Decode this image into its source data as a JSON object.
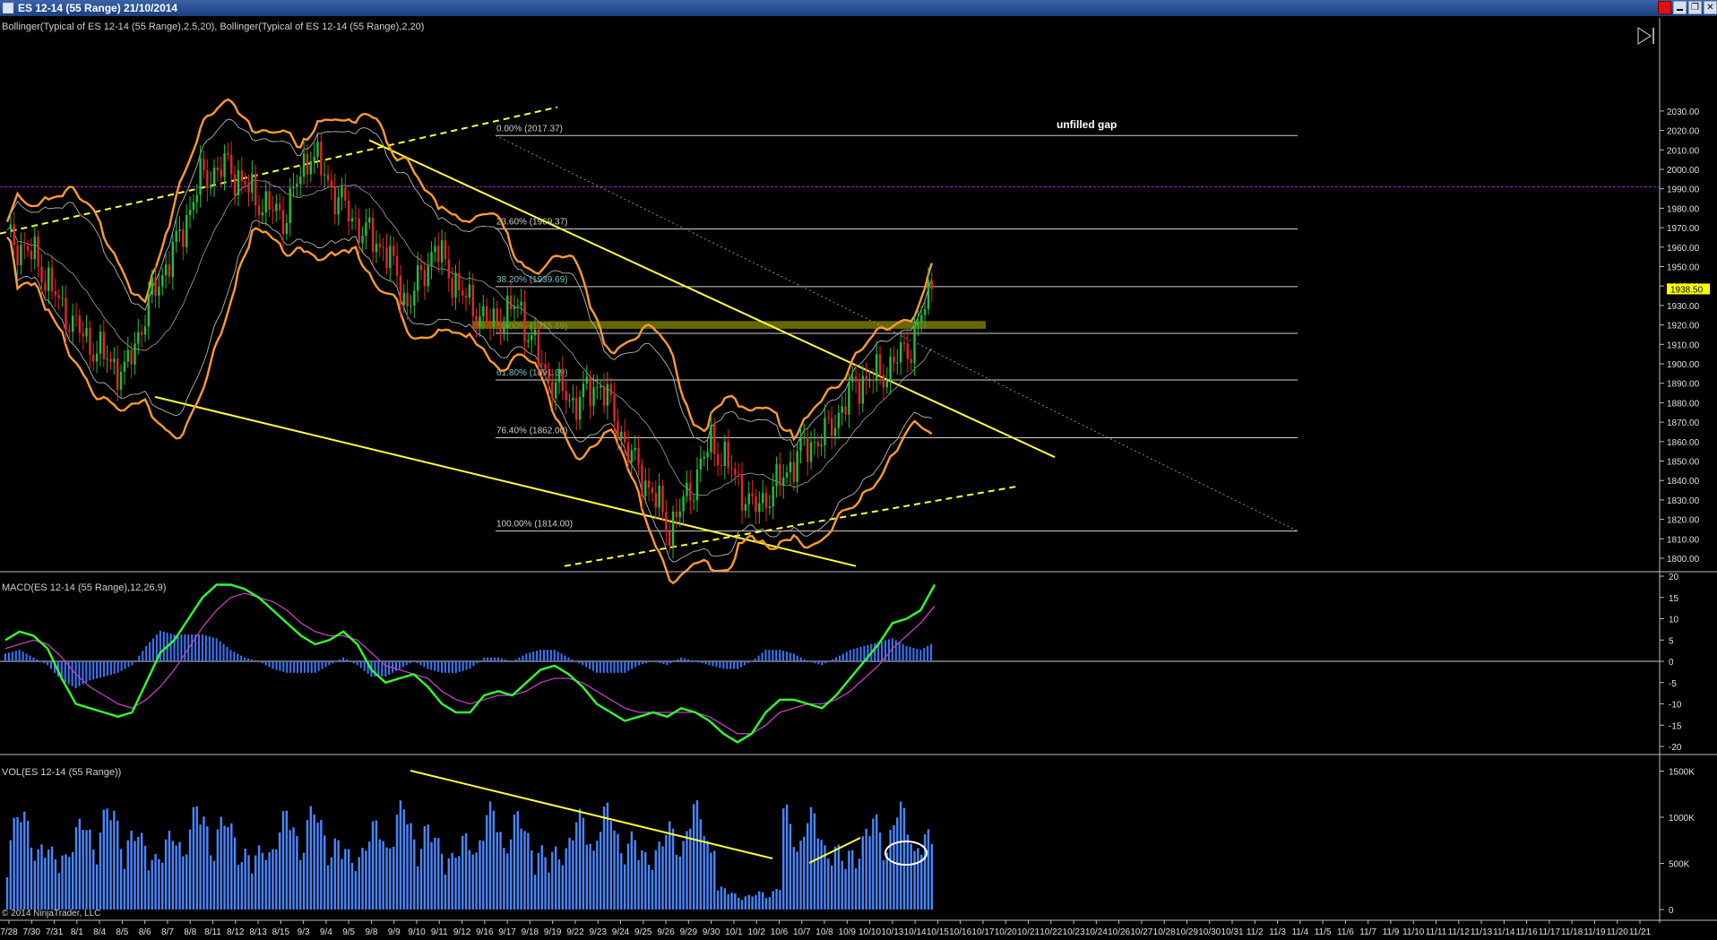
{
  "window": {
    "title": "ES 12-14 (55 Range)  21/10/2014",
    "red_square_color": "#e01010",
    "restore_glyph": "❐",
    "close_glyph": "✕"
  },
  "copyright": "© 2014 NinjaTrader, LLC",
  "chart_data": [
    {
      "type": "candlestick",
      "title": "",
      "indicator_label": "Bollinger(Typical of ES 12-14 (55 Range),2.5,20), Bollinger(Typical of ES 12-14 (55 Range),2,20)",
      "y_ticks": [
        1800,
        1810,
        1820,
        1830,
        1840,
        1850,
        1860,
        1870,
        1880,
        1890,
        1900,
        1910,
        1920,
        1930,
        1940,
        1950,
        1960,
        1970,
        1980,
        1990,
        2000,
        2010,
        2020,
        2030
      ],
      "ylim": [
        1796,
        2033
      ],
      "grid": false,
      "last_price": 1938.5,
      "last_price_label": "1938.50",
      "gap_level": 1991,
      "gap_label": "unfilled gap",
      "zone_band": [
        1918,
        1922
      ],
      "fibonacci": [
        {
          "label": "0.00% (2017.37)",
          "value": 2017.37
        },
        {
          "label": "23.60% (1969.37)",
          "value": 1969.37
        },
        {
          "label": "38.20% (1939.69)",
          "value": 1939.69
        },
        {
          "label": "50.00% (1915.69)",
          "value": 1915.69
        },
        {
          "label": "61.80% (1891.69)",
          "value": 1891.69
        },
        {
          "label": "76.40% (1862.00)",
          "value": 1862.0
        },
        {
          "label": "100.00% (1814.00)",
          "value": 1814.0
        }
      ],
      "price_path": [
        {
          "bar": 0,
          "price": 1965
        },
        {
          "bar": 8,
          "price": 1955
        },
        {
          "bar": 16,
          "price": 1928
        },
        {
          "bar": 24,
          "price": 1910
        },
        {
          "bar": 34,
          "price": 1895
        },
        {
          "bar": 42,
          "price": 1935
        },
        {
          "bar": 50,
          "price": 1965
        },
        {
          "bar": 56,
          "price": 1995
        },
        {
          "bar": 64,
          "price": 2002
        },
        {
          "bar": 72,
          "price": 1985
        },
        {
          "bar": 80,
          "price": 1975
        },
        {
          "bar": 88,
          "price": 2010
        },
        {
          "bar": 94,
          "price": 1990
        },
        {
          "bar": 102,
          "price": 1970
        },
        {
          "bar": 110,
          "price": 1958
        },
        {
          "bar": 116,
          "price": 1930
        },
        {
          "bar": 124,
          "price": 1960
        },
        {
          "bar": 132,
          "price": 1935
        },
        {
          "bar": 140,
          "price": 1920
        },
        {
          "bar": 148,
          "price": 1930
        },
        {
          "bar": 156,
          "price": 1895
        },
        {
          "bar": 164,
          "price": 1880
        },
        {
          "bar": 172,
          "price": 1890
        },
        {
          "bar": 180,
          "price": 1855
        },
        {
          "bar": 188,
          "price": 1830
        },
        {
          "bar": 192,
          "price": 1815
        },
        {
          "bar": 198,
          "price": 1835
        },
        {
          "bar": 204,
          "price": 1860
        },
        {
          "bar": 210,
          "price": 1845
        },
        {
          "bar": 216,
          "price": 1825
        },
        {
          "bar": 222,
          "price": 1835
        },
        {
          "bar": 230,
          "price": 1855
        },
        {
          "bar": 238,
          "price": 1865
        },
        {
          "bar": 246,
          "price": 1890
        },
        {
          "bar": 254,
          "price": 1895
        },
        {
          "bar": 262,
          "price": 1910
        },
        {
          "bar": 268,
          "price": 1938.5
        }
      ],
      "x_ticks": [
        "7/28",
        "7/30",
        "7/31",
        "8/1",
        "8/4",
        "8/5",
        "8/6",
        "8/7",
        "8/8",
        "8/11",
        "8/12",
        "8/13",
        "8/15",
        "9/3",
        "9/4",
        "9/5",
        "9/8",
        "9/9",
        "9/10",
        "9/11",
        "9/12",
        "9/16",
        "9/17",
        "9/18",
        "9/19",
        "9/22",
        "9/23",
        "9/24",
        "9/25",
        "9/26",
        "9/29",
        "9/30",
        "10/1",
        "10/2",
        "10/6",
        "10/7",
        "10/8",
        "10/9",
        "10/10",
        "10/13",
        "10/14",
        "10/15",
        "10/16",
        "10/17",
        "10/20",
        "10/21",
        "10/22",
        "10/23",
        "10/24",
        "10/26",
        "10/27",
        "10/28",
        "10/29",
        "10/30",
        "10/31",
        "11/2",
        "11/3",
        "11/4",
        "11/5",
        "11/6",
        "11/7",
        "11/9",
        "11/10",
        "11/11",
        "11/12",
        "11/13",
        "11/14",
        "11/16",
        "11/17",
        "11/18",
        "11/19",
        "11/20",
        "11/21"
      ],
      "colors": {
        "up": "#20c040",
        "down": "#e02828",
        "bollinger_outer": "#ff9a2e",
        "bollinger_inner": "#b4b4b4",
        "trendline": "#ffff3a",
        "gap_line": "#a020c0",
        "zone": "#8a8a00",
        "price_tag": "#ffff00"
      }
    },
    {
      "type": "line",
      "title": "MACD(ES 12-14 (55 Range),12,26,9)",
      "y_ticks": [
        -20,
        -15,
        -10,
        -5,
        0,
        5,
        10,
        15,
        20
      ],
      "ylim": [
        -23,
        22
      ],
      "series": [
        {
          "name": "",
          "values": [
            5,
            7,
            6,
            3,
            -4,
            -10,
            -11,
            -12,
            -13,
            -12,
            -5,
            2,
            5,
            10,
            15,
            18,
            18,
            17,
            15,
            12,
            9,
            6,
            4,
            5,
            7,
            4,
            -2,
            -5,
            -4,
            -3,
            -6,
            -10,
            -12,
            -12,
            -8,
            -7,
            -8,
            -5,
            -2,
            -1,
            -3,
            -6,
            -10,
            -12,
            -14,
            -13,
            -12,
            -13,
            -11,
            -12,
            -14,
            -17,
            -19,
            -17,
            -12,
            -9,
            -9,
            -10,
            -11,
            -8,
            -4,
            0,
            4,
            9,
            10,
            12,
            18
          ]
        },
        {
          "name": "",
          "values": [
            3,
            4,
            5,
            4,
            1,
            -3,
            -6,
            -8,
            -10,
            -11,
            -9,
            -6,
            -2,
            3,
            8,
            12,
            15,
            16,
            15,
            14,
            12,
            9,
            7,
            6,
            6,
            5,
            2,
            -1,
            -2,
            -3,
            -4,
            -7,
            -9,
            -10,
            -9,
            -8,
            -8,
            -7,
            -5,
            -4,
            -4,
            -5,
            -7,
            -9,
            -11,
            -12,
            -12,
            -12,
            -12,
            -12,
            -13,
            -15,
            -17,
            -17,
            -15,
            -12,
            -11,
            -10,
            -10,
            -9,
            -7,
            -4,
            -1,
            3,
            6,
            9,
            13
          ]
        }
      ],
      "colors": {
        "macd": "#30ff30",
        "signal": "#c040c0",
        "hist": "#3a78ff",
        "zero": "#cccccc"
      }
    },
    {
      "type": "bar",
      "title": "VOL(ES 12-14 (55 Range))",
      "y_ticks": [
        0,
        500000,
        1000000,
        1500000
      ],
      "y_tick_labels": [
        "0",
        "500K",
        "1000K",
        "1500K"
      ],
      "ylim": [
        0,
        1620000
      ],
      "colors": {
        "bar": "#4a86ff",
        "trend": "#ffff3a",
        "circle": "#ffffff"
      }
    }
  ]
}
